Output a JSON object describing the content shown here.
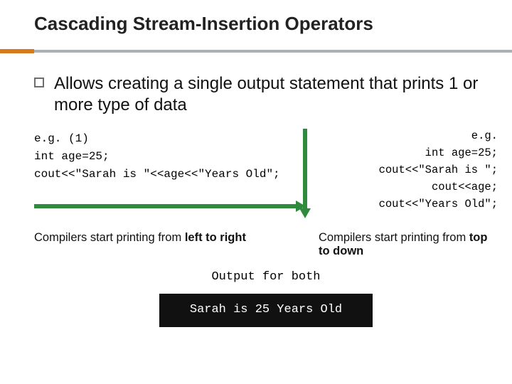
{
  "title": "Cascading Stream-Insertion Operators",
  "bullet": "Allows creating a single output statement that prints 1 or more type of data",
  "left_code": {
    "l1": "e.g. (1)",
    "l2": "int age=25;",
    "l3": "cout<<\"Sarah is \"<<age<<\"Years Old\";"
  },
  "right_code": {
    "l1": "e.g.",
    "l2": "int age=25;",
    "l3": "cout<<\"Sarah is \";",
    "l4": "cout<<age;",
    "l5": "cout<<\"Years Old\";"
  },
  "captions": {
    "left_lead": "Compilers start printing from ",
    "left_em": "left to right",
    "right_lead": "Compilers start printing from ",
    "right_em": "top to down"
  },
  "output_label": "Output for both",
  "output_text": "Sarah is 25 Years Old"
}
